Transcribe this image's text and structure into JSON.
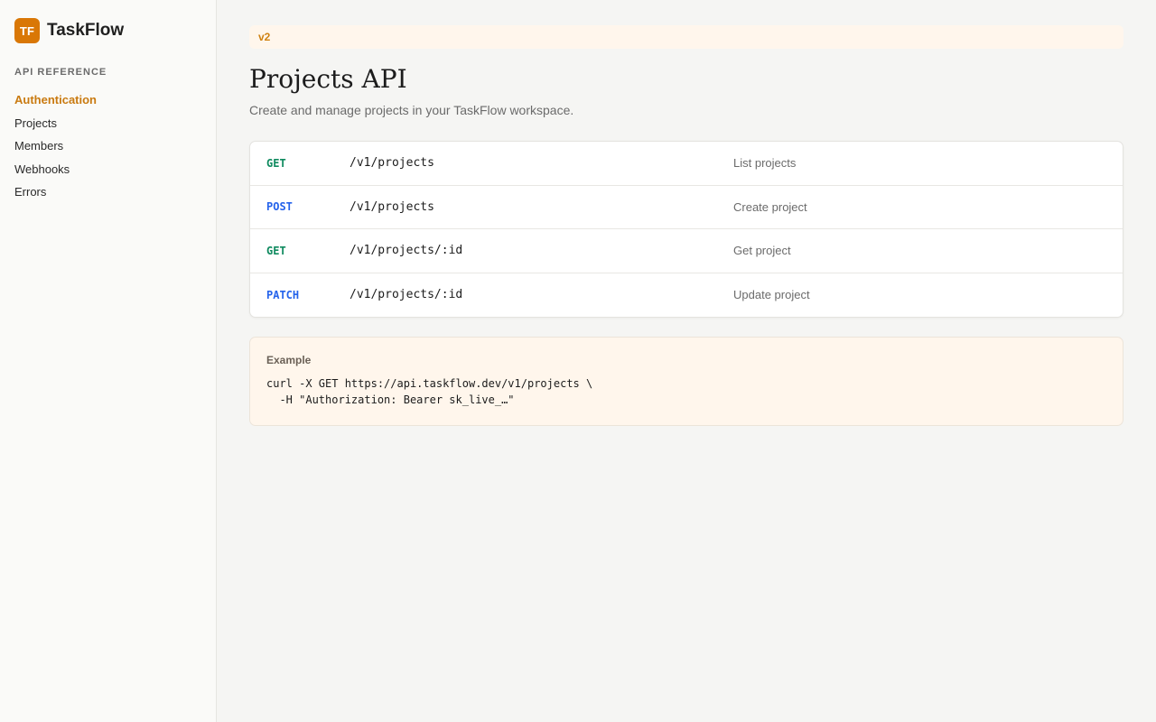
{
  "brand": {
    "logo_text": "TF",
    "name": "TaskFlow"
  },
  "sidebar": {
    "section_title": "API REFERENCE",
    "items": [
      {
        "label": "Authentication",
        "active": true
      },
      {
        "label": "Projects",
        "active": false
      },
      {
        "label": "Members",
        "active": false
      },
      {
        "label": "Webhooks",
        "active": false
      },
      {
        "label": "Errors",
        "active": false
      }
    ]
  },
  "main": {
    "version": "v2",
    "title": "Projects API",
    "description": "Create and manage projects in your TaskFlow workspace.",
    "endpoints": [
      {
        "method": "GET",
        "path": "/v1/projects",
        "description": "List projects",
        "color": "#0f8a5f"
      },
      {
        "method": "POST",
        "path": "/v1/projects",
        "description": "Create project",
        "color": "#2563eb"
      },
      {
        "method": "GET",
        "path": "/v1/projects/:id",
        "description": "Get project",
        "color": "#0f8a5f"
      },
      {
        "method": "PATCH",
        "path": "/v1/projects/:id",
        "description": "Update project",
        "color": "#2563eb"
      }
    ],
    "example": {
      "label": "Example",
      "code": "curl -X GET https://api.taskflow.dev/v1/projects \\\n  -H \"Authorization: Bearer sk_live_…\""
    }
  },
  "colors": {
    "accent": "#d97706",
    "get": "#0f8a5f",
    "write": "#2563eb"
  }
}
